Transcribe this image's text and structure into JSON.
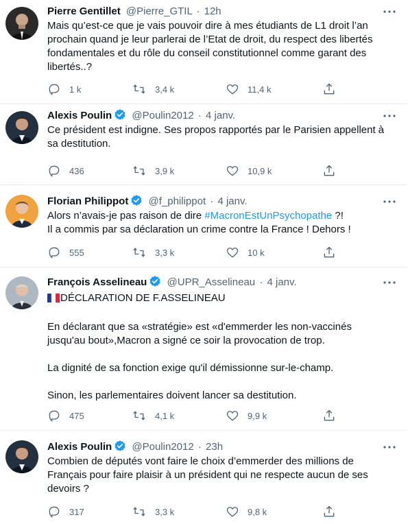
{
  "tweets": [
    {
      "name": "Pierre Gentillet",
      "verified": false,
      "handle": "@Pierre_GTIL",
      "dot": "·",
      "time": "12h",
      "paragraphs": [
        {
          "text": "Mais qu’est-ce que je vais pouvoir dire à mes étudiants de L1 droit l’an prochain quand je leur parlerai de l’Etat de droit, du respect des libertés fondamentales et du rôle du conseil constitutionnel comme garant des libertés..?"
        }
      ],
      "replies": "1 k",
      "retweets": "3,4 k",
      "likes": "11,4 k",
      "avatar_color": "#3a3a3a"
    },
    {
      "name": "Alexis Poulin",
      "verified": true,
      "handle": "@Poulin2012",
      "dot": "·",
      "time": "4 janv.",
      "paragraphs": [
        {
          "text": "Ce président est indigne. Ses propos rapportés par le Parisien appellent à sa destitution."
        }
      ],
      "replies": "436",
      "retweets": "3,9 k",
      "likes": "10,9 k",
      "avatar_color": "#2b3a4a"
    },
    {
      "name": "Florian Philippot",
      "verified": true,
      "handle": "@f_philippot",
      "dot": "·",
      "time": "4 janv.",
      "paragraphs": [
        {
          "before": "Alors n’avais-je pas raison de dire ",
          "hashtag": "#MacronEstUnPsychopathe",
          "after": " ?!"
        },
        {
          "text": "Il a commis par sa déclaration un crime contre la France ! Dehors !"
        }
      ],
      "replies": "555",
      "retweets": "3,3 k",
      "likes": "10 k",
      "avatar_color": "#e9882f"
    },
    {
      "name": "François Asselineau",
      "verified": true,
      "handle": "@UPR_Asselineau",
      "dot": "·",
      "time": "4 janv.",
      "paragraphs": [
        {
          "flag": true,
          "text": "DÉCLARATION DE F.ASSELINEAU"
        },
        {
          "text": "En déclarant que sa «stratégie» est «d'emmerder les non-vaccinés jusqu'au bout»,Macron a signé ce soir la provocation de trop.",
          "gap": true
        },
        {
          "text": "La dignité de sa fonction exige qu'il démissionne sur-le-champ.",
          "gap": true
        },
        {
          "text": "Sinon, les parlementaires doivent lancer sa destitution.",
          "gap": true
        }
      ],
      "replies": "475",
      "retweets": "4,1 k",
      "likes": "9,9 k",
      "avatar_color": "#b9c2cc"
    },
    {
      "name": "Alexis Poulin",
      "verified": true,
      "handle": "@Poulin2012",
      "dot": "·",
      "time": "23h",
      "paragraphs": [
        {
          "text": "Combien de députés vont faire le choix d’emmerder des millions de Français pour faire plaisir à un président qui ne respecte aucun de ses devoirs ?"
        }
      ],
      "replies": "317",
      "retweets": "3,3 k",
      "likes": "9,8 k",
      "avatar_color": "#2b3a4a"
    }
  ],
  "icons": {
    "reply": "reply-icon",
    "retweet": "retweet-icon",
    "like": "like-icon",
    "share": "share-icon",
    "more": "more-icon",
    "verified": "verified-badge-icon"
  },
  "colors": {
    "text": "#0f1419",
    "secondary": "#536471",
    "accent": "#1d9bf0",
    "border": "#e6ecf0"
  }
}
